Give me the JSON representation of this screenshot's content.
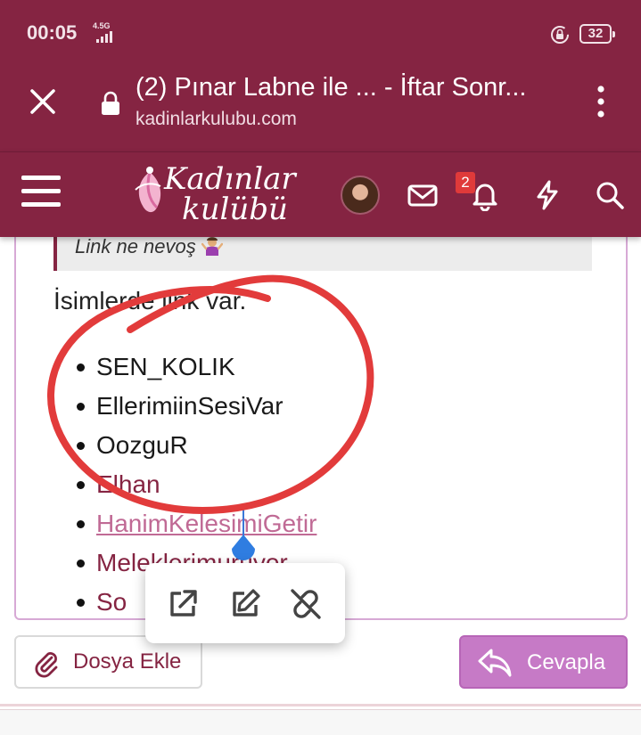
{
  "status_bar": {
    "time": "00:05",
    "network": "4.5G",
    "battery": "32"
  },
  "browser": {
    "tab_title": "(2) Pınar Labne ile ... - İftar Sonr...",
    "domain": "kadinlarkulubu.com"
  },
  "site": {
    "logo_line1": "Kadınlar",
    "logo_line2": "kulübü",
    "notification_count": "2"
  },
  "post": {
    "quote": "Link ne nevoş",
    "paragraph": "İsimlerde link var.",
    "names": [
      {
        "text": "SEN_KOLIK",
        "link": false
      },
      {
        "text": "EllerimiinSesiVar",
        "link": false
      },
      {
        "text": "OozguR",
        "link": false
      },
      {
        "text": "Elhan",
        "link": true
      },
      {
        "text": "HanimKelesimiGetir",
        "link": true,
        "selected": true
      },
      {
        "text": "Meleklerimuruyor",
        "link": true
      },
      {
        "text": "So",
        "link": true
      }
    ]
  },
  "popup": {
    "actions": [
      "open-link",
      "edit-link",
      "unlink"
    ]
  },
  "buttons": {
    "attach": "Dosya Ekle",
    "reply": "Cevapla"
  },
  "colors": {
    "brand": "#852442",
    "reply_button": "#c67ac6",
    "annotation_red": "#e23b3b",
    "selection_blue": "#2f7de1"
  }
}
